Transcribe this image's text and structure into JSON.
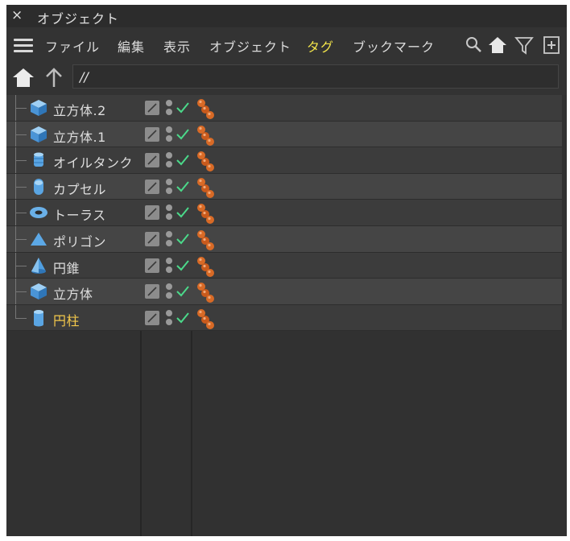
{
  "window": {
    "close_glyph": "×",
    "title": "オブジェクト"
  },
  "menu": {
    "items": [
      "ファイル",
      "編集",
      "表示",
      "オブジェクト",
      "タグ",
      "ブックマーク"
    ],
    "active_index": 4,
    "tools": [
      "search-icon",
      "home-icon",
      "filter-icon",
      "new-panel-icon"
    ]
  },
  "path": {
    "value": "//"
  },
  "objects": [
    {
      "name": "立方体.2",
      "icon": "cube-icon"
    },
    {
      "name": "立方体.1",
      "icon": "cube-icon"
    },
    {
      "name": "オイルタンク",
      "icon": "oiltank-icon"
    },
    {
      "name": "カプセル",
      "icon": "capsule-icon"
    },
    {
      "name": "トーラス",
      "icon": "torus-icon"
    },
    {
      "name": "ポリゴン",
      "icon": "polygon-icon"
    },
    {
      "name": "円錐",
      "icon": "cone-icon"
    },
    {
      "name": "立方体",
      "icon": "cube-icon"
    },
    {
      "name": "円柱",
      "icon": "cylinder-icon",
      "selected": true
    }
  ],
  "colors": {
    "accent": "#f0e24a",
    "selected_text": "#f3c84b",
    "icon_blue": "#5ca8e6",
    "check_green": "#4bd98a",
    "tag_orange": "#d86a26"
  }
}
